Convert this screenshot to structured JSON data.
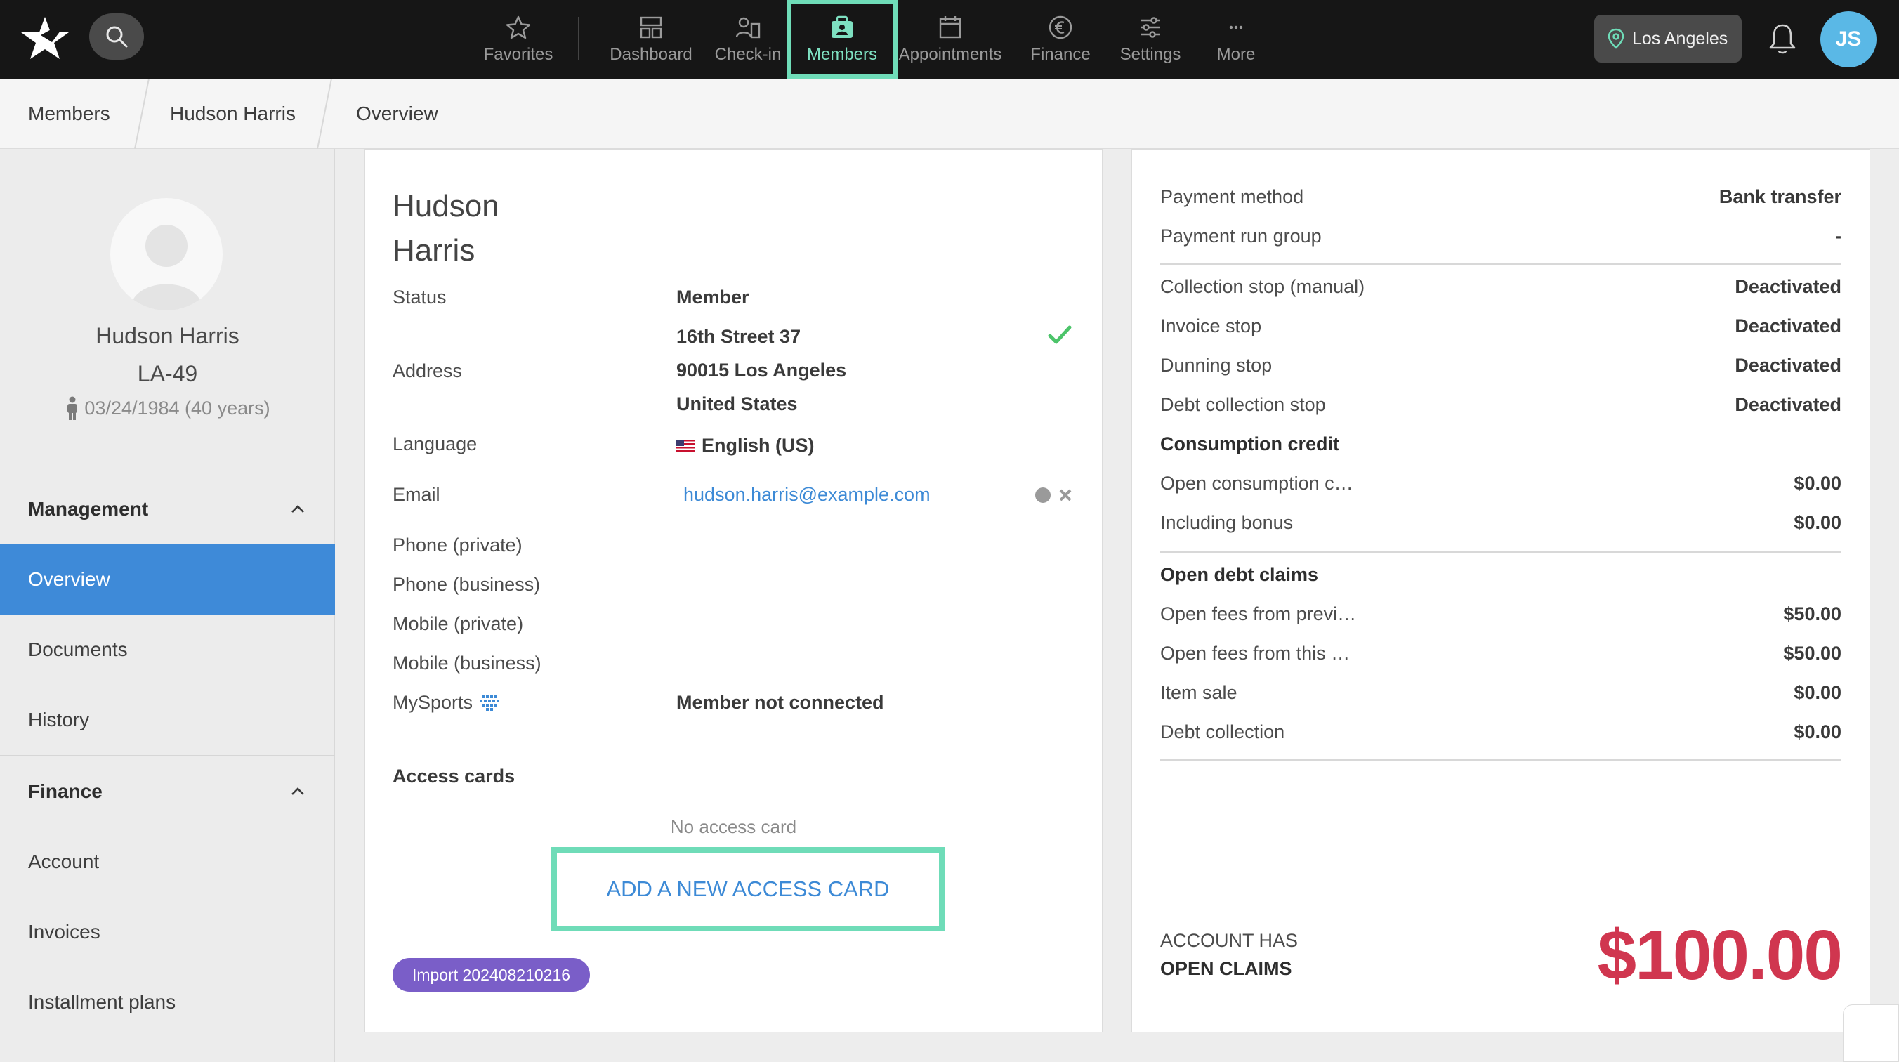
{
  "topnav": {
    "items": [
      {
        "label": "Favorites",
        "icon": "star-icon"
      },
      {
        "label": "Dashboard",
        "icon": "dashboard-icon"
      },
      {
        "label": "Check-in",
        "icon": "check-in-icon"
      },
      {
        "label": "Members",
        "icon": "members-icon",
        "active": true
      },
      {
        "label": "Appointments",
        "icon": "calendar-icon"
      },
      {
        "label": "Finance",
        "icon": "euro-icon"
      },
      {
        "label": "Settings",
        "icon": "sliders-icon"
      },
      {
        "label": "More",
        "icon": "more-dots-icon"
      }
    ],
    "location": "Los Angeles",
    "user_initials": "JS"
  },
  "breadcrumb": [
    "Members",
    "Hudson Harris",
    "Overview"
  ],
  "sidebar": {
    "profile": {
      "name": "Hudson Harris",
      "member_id": "LA-49",
      "dob": "03/24/1984 (40 years)"
    },
    "sections": [
      {
        "title": "Management",
        "items": [
          "Overview",
          "Documents",
          "History"
        ]
      },
      {
        "title": "Finance",
        "items": [
          "Account",
          "Invoices",
          "Installment plans"
        ]
      }
    ]
  },
  "member": {
    "first_name": "Hudson",
    "last_name": "Harris",
    "status_label": "Status",
    "status_value": "Member",
    "address_label": "Address",
    "address": [
      "16th Street 37",
      "90015 Los Angeles",
      "United States"
    ],
    "language_label": "Language",
    "language_value": "English (US)",
    "email_label": "Email",
    "email_value": "hudson.harris@example.com",
    "phone_private_label": "Phone (private)",
    "phone_business_label": "Phone (business)",
    "mobile_private_label": "Mobile (private)",
    "mobile_business_label": "Mobile (business)",
    "mysports_label": "MySports",
    "mysports_value": "Member not connected",
    "access_cards_label": "Access cards",
    "no_access_card": "No access card",
    "add_access_card": "ADD A NEW ACCESS CARD",
    "import_tag": "Import 202408210216"
  },
  "finance": {
    "payment_method_label": "Payment method",
    "payment_method_value": "Bank transfer",
    "payment_run_group_label": "Payment run group",
    "payment_run_group_value": "-",
    "collection_stop_label": "Collection stop (manual)",
    "collection_stop_value": "Deactivated",
    "invoice_stop_label": "Invoice stop",
    "invoice_stop_value": "Deactivated",
    "dunning_stop_label": "Dunning stop",
    "dunning_stop_value": "Deactivated",
    "debt_collection_stop_label": "Debt collection stop",
    "debt_collection_stop_value": "Deactivated",
    "consumption_credit_head": "Consumption credit",
    "open_consumption_label": "Open consumption c…",
    "open_consumption_value": "$0.00",
    "including_bonus_label": "Including bonus",
    "including_bonus_value": "$0.00",
    "open_debt_head": "Open debt claims",
    "open_fees_prev_label": "Open fees from previ…",
    "open_fees_prev_value": "$50.00",
    "open_fees_this_label": "Open fees from this …",
    "open_fees_this_value": "$50.00",
    "item_sale_label": "Item sale",
    "item_sale_value": "$0.00",
    "debt_collection_label": "Debt collection",
    "debt_collection_value": "$0.00",
    "claims_line1": "ACCOUNT HAS",
    "claims_line2": "OPEN CLAIMS",
    "claims_total": "$100.00"
  },
  "colors": {
    "accent": "#3e8ad8",
    "highlight": "#6fdcb8",
    "claims_red": "#d0364f",
    "tag_purple": "#7a5ec8"
  }
}
